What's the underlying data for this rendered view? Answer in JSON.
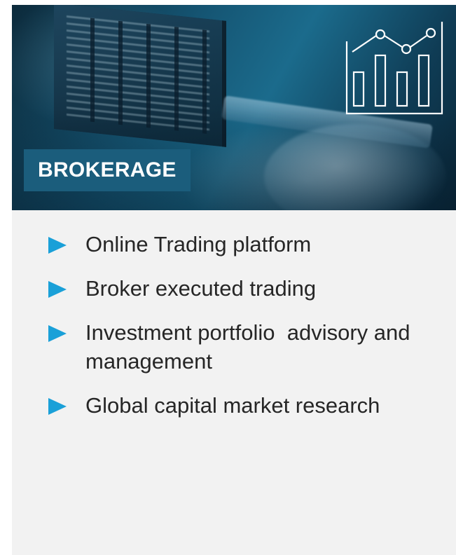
{
  "hero": {
    "title": "BROKERAGE",
    "icon": "line-and-bar-chart-icon",
    "title_bg_color": "#1b5d7c",
    "icon_color": "#ffffff"
  },
  "services": {
    "bullet_color": "#1aa0d8",
    "items": [
      {
        "label": "Online Trading platform"
      },
      {
        "label": "Broker executed trading"
      },
      {
        "label": "Investment portfolio  advisory and management"
      },
      {
        "label": "Global capital market research"
      }
    ]
  }
}
